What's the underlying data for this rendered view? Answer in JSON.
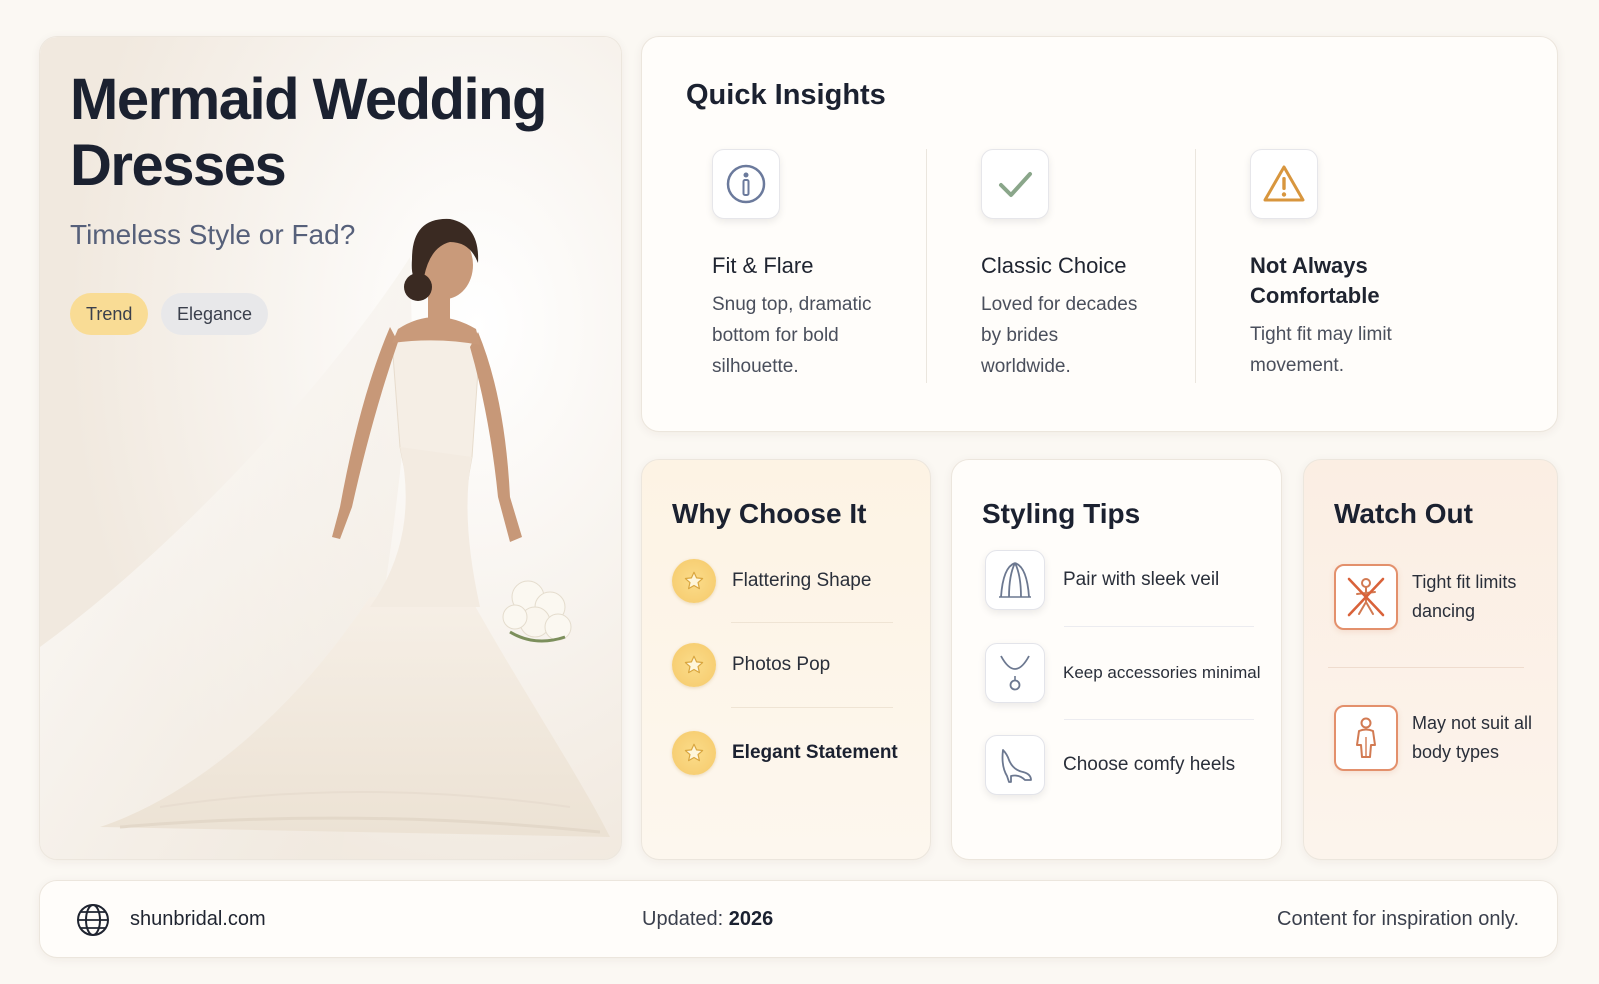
{
  "hero": {
    "title": "Mermaid Wedding Dresses",
    "subtitle": "Timeless Style or Fad?",
    "tags": [
      "Trend",
      "Elegance"
    ]
  },
  "insights": {
    "title": "Quick Insights",
    "items": [
      {
        "icon": "info-icon",
        "heading": "Fit & Flare",
        "text": "Snug top, dramatic bottom for bold silhouette."
      },
      {
        "icon": "check-icon",
        "heading": "Classic Choice",
        "text": "Loved for decades by brides worldwide."
      },
      {
        "icon": "warning-icon",
        "heading": "Not Always Comfortable",
        "text": "Tight fit may limit movement."
      }
    ]
  },
  "why": {
    "title": "Why Choose It",
    "items": [
      "Flattering Shape",
      "Photos Pop",
      "Elegant Statement"
    ]
  },
  "tips": {
    "title": "Styling Tips",
    "items": [
      {
        "icon": "veil-icon",
        "label": "Pair with sleek veil"
      },
      {
        "icon": "necklace-icon",
        "label": "Keep accessories minimal"
      },
      {
        "icon": "heel-icon",
        "label": "Choose comfy heels"
      }
    ]
  },
  "watch": {
    "title": "Watch Out",
    "items": [
      {
        "icon": "no-dancing-icon",
        "label": "Tight fit limits dancing"
      },
      {
        "icon": "body-type-icon",
        "label": "May not suit all body types"
      }
    ]
  },
  "footer": {
    "site": "shunbridal.com",
    "updated_label": "Updated:",
    "updated_year": "2026",
    "disclaimer": "Content for inspiration only."
  },
  "colors": {
    "background": "#fbf8f3",
    "accent_yellow": "#f9dc95",
    "warning_orange": "#e3906c",
    "title_dark": "#1b2130"
  }
}
